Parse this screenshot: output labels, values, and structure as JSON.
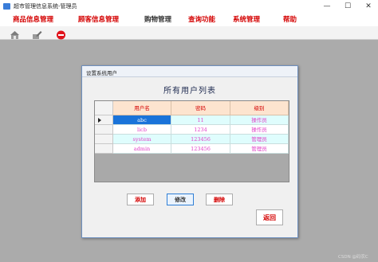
{
  "window": {
    "title": "超市管理信息系统-管理员",
    "minimize_glyph": "—",
    "maximize_glyph": "☐",
    "close_glyph": "✕"
  },
  "menu": {
    "items": [
      {
        "label": "商品信息管理"
      },
      {
        "label": "顾客信息管理"
      },
      {
        "label": "购物管理"
      },
      {
        "label": "查询功能"
      },
      {
        "label": "系统管理"
      },
      {
        "label": "帮助"
      }
    ]
  },
  "toolbar": {
    "icons": [
      "house-icon",
      "edit-icon",
      "stop-icon"
    ]
  },
  "dialog": {
    "title": "设置系统用户",
    "heading": "所有用户列表",
    "columns": [
      "用户名",
      "密码",
      "级别"
    ],
    "rows": [
      {
        "username": "abc",
        "password": "11",
        "level": "操作员"
      },
      {
        "username": "licb",
        "password": "1234",
        "level": "操作员"
      },
      {
        "username": "system",
        "password": "123456",
        "level": "管理员"
      },
      {
        "username": "admin",
        "password": "123456",
        "level": "管理员"
      }
    ],
    "buttons": {
      "add": "添加",
      "edit": "修改",
      "delete": "删除",
      "back": "返回"
    }
  },
  "watermark": "CSDN @码农C"
}
